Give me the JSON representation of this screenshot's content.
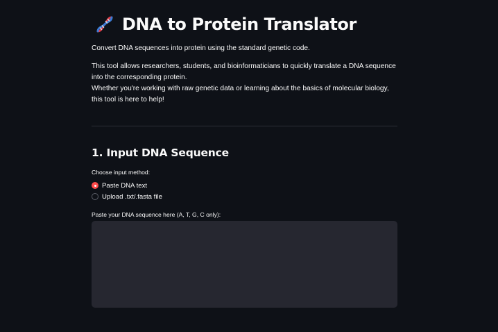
{
  "header": {
    "icon": "dna-icon",
    "title": "DNA to Protein Translator"
  },
  "intro": {
    "subtitle": "Convert DNA sequences into protein using the standard genetic code.",
    "description_line1": "This tool allows researchers, students, and bioinformaticians to quickly translate a DNA sequence into the corresponding protein.",
    "description_line2": "Whether you're working with raw genetic data or learning about the basics of molecular biology, this tool is here to help!"
  },
  "section1": {
    "heading": "1. Input DNA Sequence",
    "method_label": "Choose input method:",
    "options": [
      {
        "label": "Paste DNA text",
        "selected": true
      },
      {
        "label": "Upload .txt/.fasta file",
        "selected": false
      }
    ],
    "textarea_label": "Paste your DNA sequence here (A, T, G, C only):",
    "textarea_value": "",
    "textarea_placeholder": ""
  },
  "colors": {
    "background": "#0e1117",
    "text": "#fafafa",
    "accent": "#ff4b4b",
    "input_bg": "#262730",
    "divider": "#2b2f38"
  }
}
